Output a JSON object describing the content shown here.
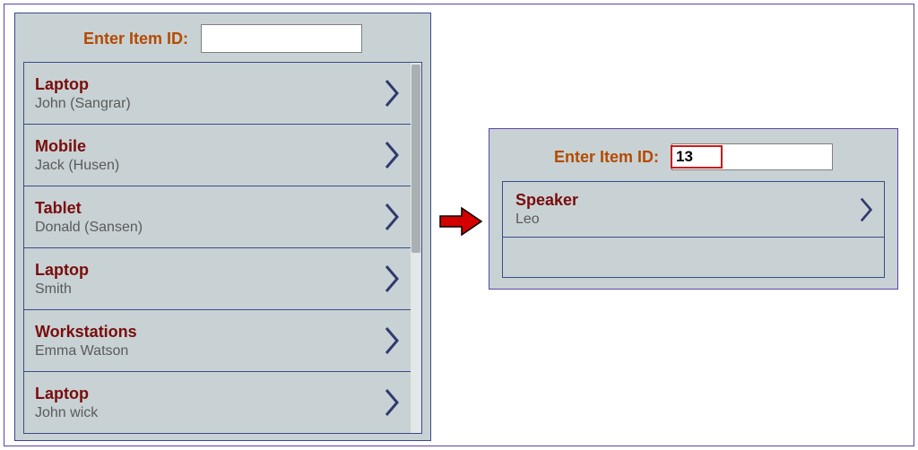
{
  "colors": {
    "panel_bg": "#c8d2d4",
    "panel_border": "#3a4a8a",
    "outer_border": "#5a43a8",
    "label": "#b54a00",
    "item_title": "#7a0c0c",
    "item_sub": "#5a5a5a",
    "highlight": "#cc1a1a",
    "arrow": "#d40000"
  },
  "left": {
    "search_label": "Enter Item ID:",
    "search_value": "",
    "search_placeholder": "",
    "items": [
      {
        "title": "Laptop",
        "sub": "John (Sangrar)"
      },
      {
        "title": "Mobile",
        "sub": "Jack (Husen)"
      },
      {
        "title": "Tablet",
        "sub": "Donald (Sansen)"
      },
      {
        "title": "Laptop",
        "sub": "Smith"
      },
      {
        "title": "Workstations",
        "sub": "Emma Watson"
      },
      {
        "title": "Laptop",
        "sub": "John wick"
      }
    ]
  },
  "right": {
    "search_label": "Enter Item ID:",
    "search_value": "13",
    "items": [
      {
        "title": "Speaker",
        "sub": "Leo"
      }
    ]
  },
  "icons": {
    "chevron_right": "chevron-right-icon",
    "arrow_right": "arrow-right-icon"
  }
}
